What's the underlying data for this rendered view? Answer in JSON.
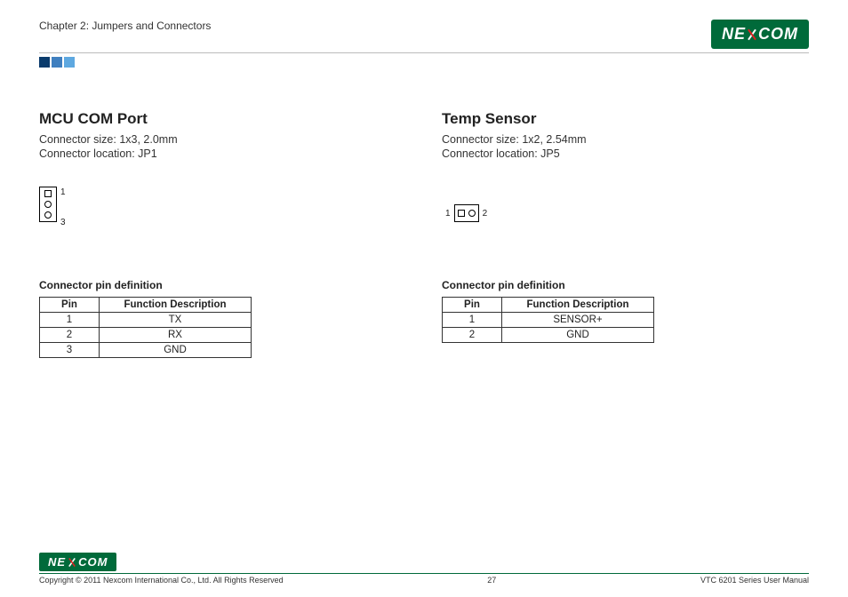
{
  "header": {
    "chapter": "Chapter 2: Jumpers and Connectors",
    "brand": "NEXCOM"
  },
  "left": {
    "title": "MCU COM Port",
    "size": "Connector size: 1x3, 2.0mm",
    "location": "Connector location: JP1",
    "pin_label_top": "1",
    "pin_label_bottom": "3",
    "table_caption": "Connector pin definition",
    "th_pin": "Pin",
    "th_func": "Function Description",
    "rows": [
      {
        "pin": "1",
        "func": "TX"
      },
      {
        "pin": "2",
        "func": "RX"
      },
      {
        "pin": "3",
        "func": "GND"
      }
    ]
  },
  "right": {
    "title": "Temp Sensor",
    "size": "Connector size: 1x2, 2.54mm",
    "location": "Connector location: JP5",
    "pin_label_left": "1",
    "pin_label_right": "2",
    "table_caption": "Connector pin definition",
    "th_pin": "Pin",
    "th_func": "Function Description",
    "rows": [
      {
        "pin": "1",
        "func": "SENSOR+"
      },
      {
        "pin": "2",
        "func": "GND"
      }
    ]
  },
  "footer": {
    "copyright": "Copyright © 2011 Nexcom International Co., Ltd. All Rights Reserved",
    "page": "27",
    "manual": "VTC 6201 Series User Manual",
    "brand": "NEXCOM"
  }
}
